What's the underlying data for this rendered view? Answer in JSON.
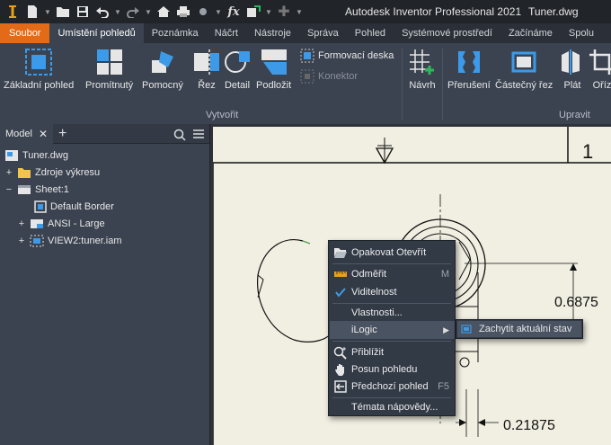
{
  "title_bar": {
    "app_title": "Autodesk Inventor Professional 2021",
    "document": "Tuner.dwg"
  },
  "ribbon_tabs": [
    "Soubor",
    "Umístění pohledů",
    "Poznámka",
    "Náčrt",
    "Nástroje",
    "Správa",
    "Pohled",
    "Systémové prostředí",
    "Začínáme",
    "Spolu"
  ],
  "ribbon": {
    "create": {
      "base_view": "Základní pohled",
      "projected": "Promítnutý",
      "auxiliary": "Pomocný",
      "section": "Řez",
      "detail": "Detail",
      "overlay": "Podložit",
      "flat_pattern": "Formovací deska",
      "connector": "Konektor",
      "group_label": "Vytvořit"
    },
    "sketch": "Návrh",
    "modify": {
      "break": "Přerušení",
      "break_out": "Částečný řez",
      "slice": "Plát",
      "crop": "Oříz",
      "group_label": "Upravit"
    }
  },
  "browser": {
    "tab_label": "Model",
    "items": [
      "Tuner.dwg",
      "Zdroje výkresu",
      "Sheet:1",
      "Default Border",
      "ANSI - Large",
      "VIEW2:tuner.iam"
    ]
  },
  "drawing": {
    "zone_number": "1",
    "dim_1": "0.6875",
    "dim_2": "0.21875"
  },
  "context_menu": {
    "repeat": "Opakovat Otevřít",
    "measure": "Odměřit",
    "measure_shortcut": "M",
    "visibility": "Viditelnost",
    "properties": "Vlastnosti...",
    "ilogic": "iLogic",
    "zoom": "Přiblížit",
    "pan": "Posun pohledu",
    "previous_view": "Předchozí pohled",
    "previous_shortcut": "F5",
    "help_topics": "Témata nápovědy..."
  },
  "submenu": {
    "capture_state": "Zachytit aktuální stav"
  },
  "colors": {
    "file_tab": "#e36a17",
    "ribbon_bg": "#3b4350",
    "sheet_bg": "#f1efe2",
    "accent_blue": "#3c9ae8"
  }
}
